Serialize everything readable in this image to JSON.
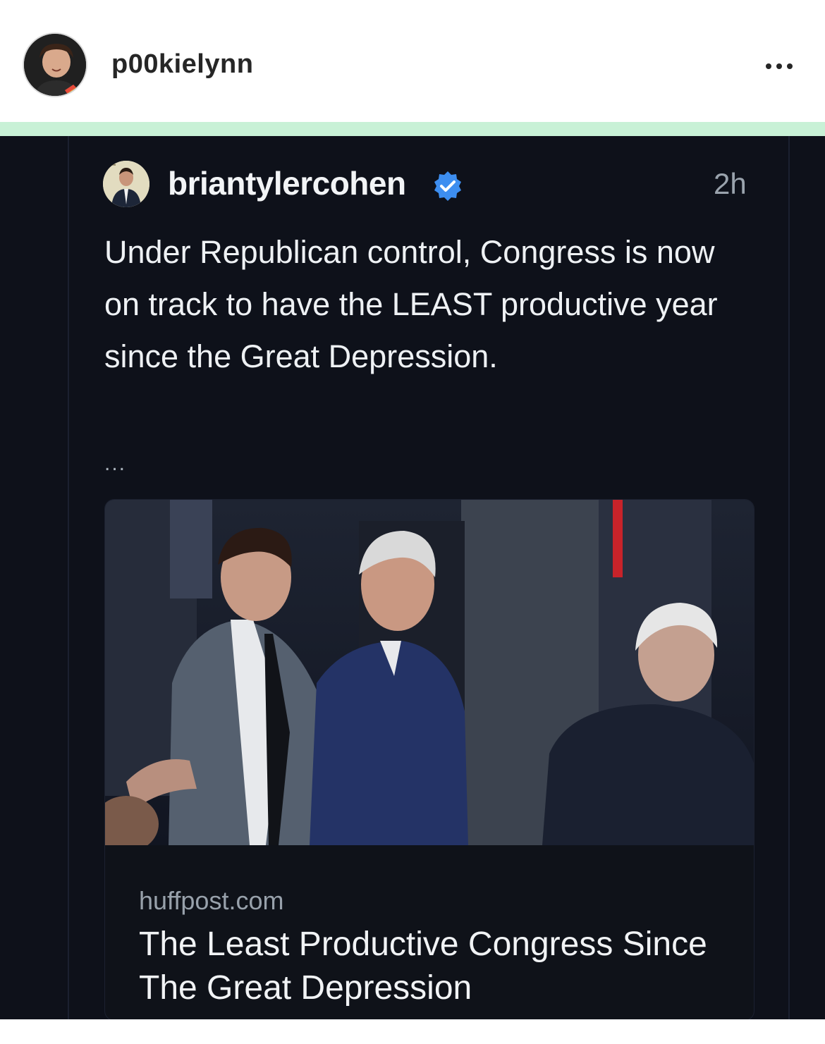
{
  "post_header": {
    "username": "p00kielynn",
    "more_icon": "more-horizontal-icon"
  },
  "thread_post": {
    "handle": "briantylercohen",
    "verified_icon": "verified-badge-icon",
    "time": "2h",
    "text": "Under Republican control, Congress is now on track to have the LEAST productive year since the Great Depression.",
    "ellipsis": "...",
    "link_card": {
      "domain": "huffpost.com",
      "title": "The Least Productive Congress Since The Great Depression"
    }
  },
  "colors": {
    "accent_strip": "#c8f1d6",
    "post_background": "#0e111a",
    "verified_blue": "#3d8ef0"
  }
}
